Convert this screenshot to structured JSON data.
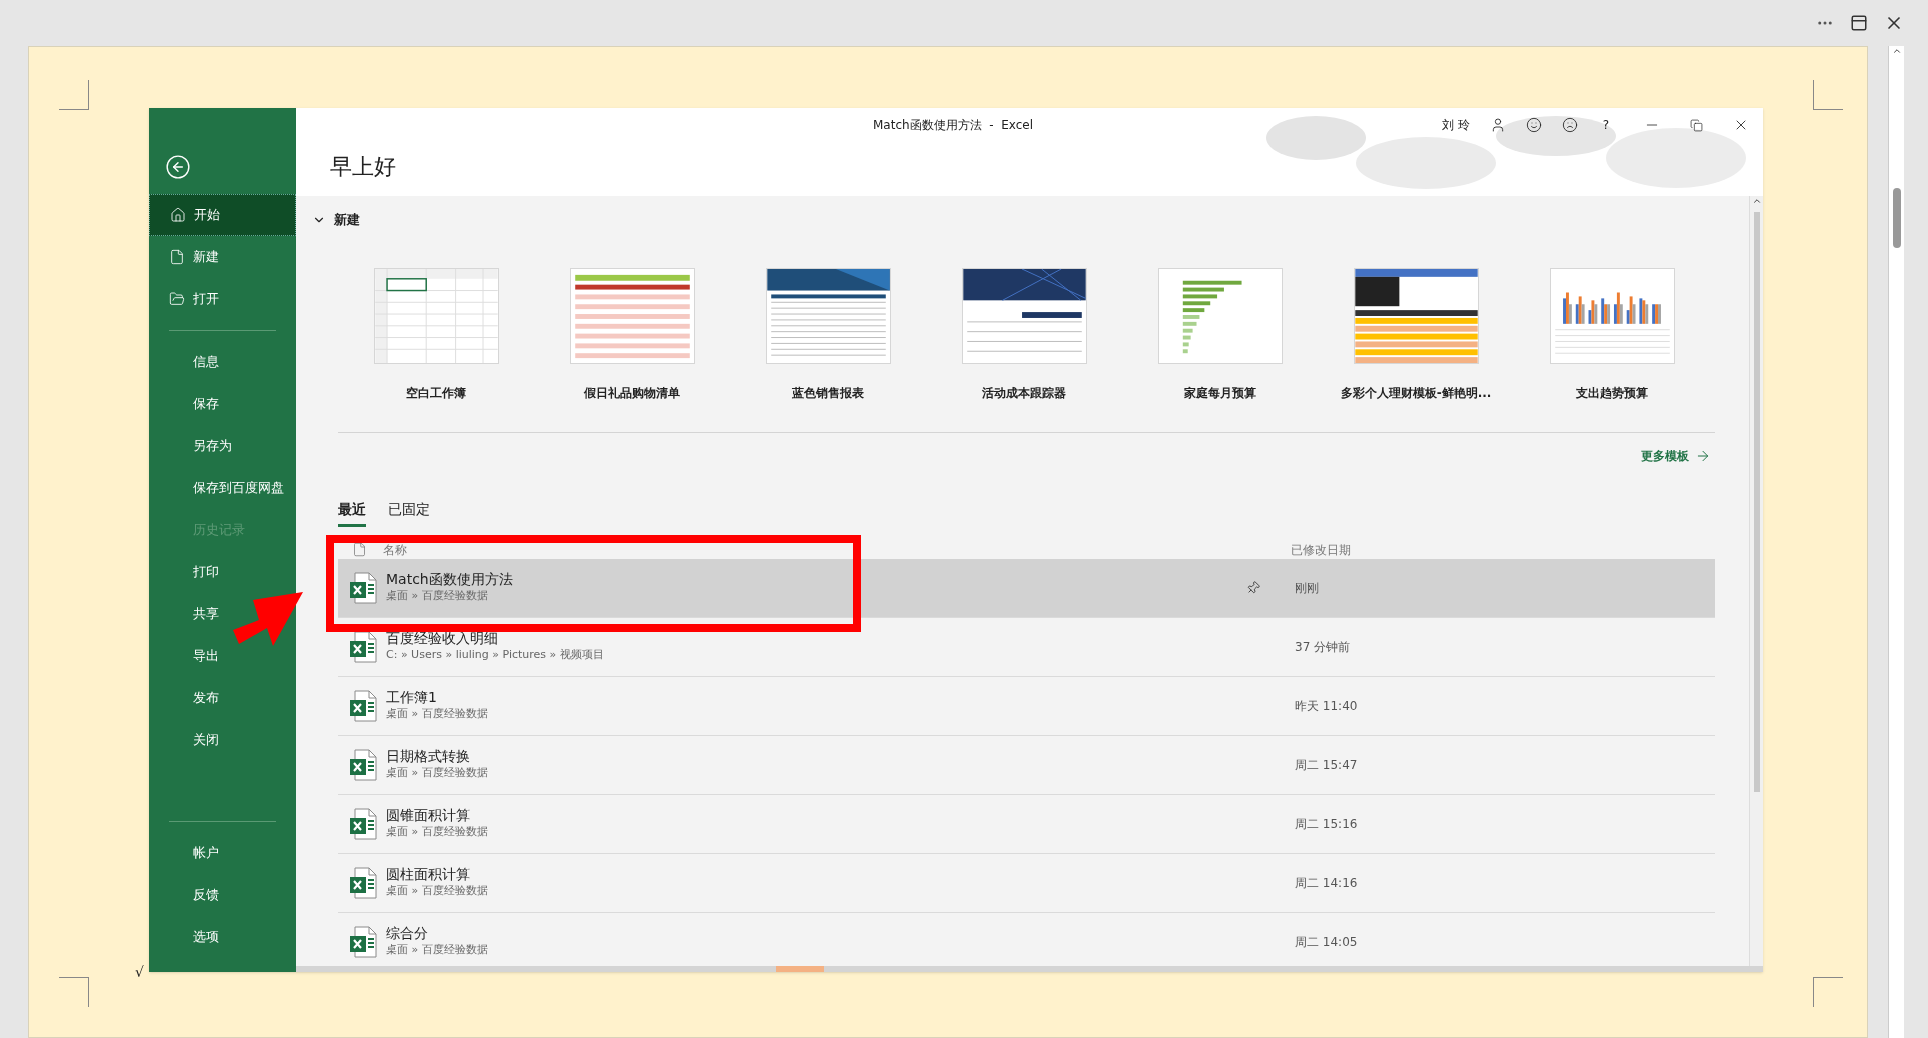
{
  "window_title": "Match函数使用方法  -  Excel",
  "user_name": "刘 玲",
  "help": "?",
  "sidebar": {
    "groups": [
      [
        {
          "label": "开始",
          "selected": true,
          "disabled": false
        },
        {
          "label": "新建",
          "selected": false,
          "disabled": false
        },
        {
          "label": "打开",
          "selected": false,
          "disabled": false
        }
      ],
      [
        {
          "label": "信息",
          "selected": false,
          "disabled": false
        },
        {
          "label": "保存",
          "selected": false,
          "disabled": false
        },
        {
          "label": "另存为",
          "selected": false,
          "disabled": false
        },
        {
          "label": "保存到百度网盘",
          "selected": false,
          "disabled": false
        },
        {
          "label": "历史记录",
          "selected": false,
          "disabled": true
        },
        {
          "label": "打印",
          "selected": false,
          "disabled": false
        },
        {
          "label": "共享",
          "selected": false,
          "disabled": false
        },
        {
          "label": "导出",
          "selected": false,
          "disabled": false
        },
        {
          "label": "发布",
          "selected": false,
          "disabled": false
        },
        {
          "label": "关闭",
          "selected": false,
          "disabled": false
        }
      ],
      [
        {
          "label": "帐户",
          "selected": false,
          "disabled": false
        },
        {
          "label": "反馈",
          "selected": false,
          "disabled": false
        },
        {
          "label": "选项",
          "selected": false,
          "disabled": false
        }
      ]
    ]
  },
  "greeting": "早上好",
  "new_section": {
    "title": "新建",
    "expanded": true
  },
  "templates": [
    {
      "label": "空白工作簿",
      "kind": "blank"
    },
    {
      "label": "假日礼品购物清单",
      "kind": "list"
    },
    {
      "label": "蓝色销售报表",
      "kind": "table"
    },
    {
      "label": "活动成本跟踪器",
      "kind": "report"
    },
    {
      "label": "家庭每月预算",
      "kind": "bars"
    },
    {
      "label": "多彩个人理财模板-鲜艳明...",
      "kind": "colorful"
    },
    {
      "label": "支出趋势预算",
      "kind": "chart"
    }
  ],
  "more_templates": "更多模板",
  "tabs": [
    {
      "label": "最近",
      "selected": true
    },
    {
      "label": "已固定",
      "selected": false
    }
  ],
  "recent": {
    "columns": [
      "名称",
      "已修改日期"
    ],
    "rows": [
      {
        "name": "Match函数使用方法",
        "path": "桌面 » 百度经验数据",
        "modified": "刚刚",
        "selected": true
      },
      {
        "name": "百度经验收入明细",
        "path": "C: » Users » liuling » Pictures » 视频项目",
        "modified": "37 分钟前",
        "selected": false
      },
      {
        "name": "工作簿1",
        "path": "桌面 » 百度经验数据",
        "modified": "昨天 11:40",
        "selected": false
      },
      {
        "name": "日期格式转换",
        "path": "桌面 » 百度经验数据",
        "modified": "周二 15:47",
        "selected": false
      },
      {
        "name": "圆锥面积计算",
        "path": "桌面 » 百度经验数据",
        "modified": "周二 15:16",
        "selected": false
      },
      {
        "name": "圆柱面积计算",
        "path": "桌面 » 百度经验数据",
        "modified": "周二 14:16",
        "selected": false
      },
      {
        "name": "综合分",
        "path": "桌面 » 百度经验数据",
        "modified": "周二 14:05",
        "selected": false
      }
    ]
  },
  "page_mark": "√"
}
